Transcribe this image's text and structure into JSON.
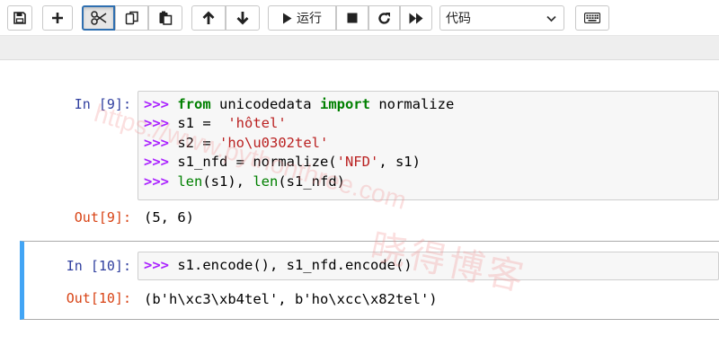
{
  "toolbar": {
    "run_label": "运行",
    "cell_type": "代码",
    "icons": [
      "save-icon",
      "plus-icon",
      "scissors-icon",
      "copy-icon",
      "paste-icon",
      "arrow-up-icon",
      "arrow-down-icon",
      "play-icon",
      "stop-icon",
      "restart-icon",
      "fast-forward-icon",
      "keyboard-icon"
    ]
  },
  "cells": [
    {
      "in_prompt": "In [9]:",
      "lines": [
        [
          {
            "t": ">>> ",
            "c": "pm"
          },
          {
            "t": "from",
            "c": "kw"
          },
          {
            "t": " unicodedata ",
            "c": ""
          },
          {
            "t": "import",
            "c": "kw"
          },
          {
            "t": " normalize",
            "c": ""
          }
        ],
        [
          {
            "t": ">>> ",
            "c": "pm"
          },
          {
            "t": "s1 = ",
            "c": ""
          },
          {
            "t": " 'hôtel'",
            "c": "st"
          }
        ],
        [
          {
            "t": ">>> ",
            "c": "pm"
          },
          {
            "t": "s2 = ",
            "c": ""
          },
          {
            "t": "'ho\\u0302tel'",
            "c": "st"
          }
        ],
        [
          {
            "t": ">>> ",
            "c": "pm"
          },
          {
            "t": "s1_nfd = normalize(",
            "c": ""
          },
          {
            "t": "'NFD'",
            "c": "st"
          },
          {
            "t": ", s1)",
            "c": ""
          }
        ],
        [
          {
            "t": ">>> ",
            "c": "pm"
          },
          {
            "t": "len",
            "c": "bi"
          },
          {
            "t": "(s1), ",
            "c": ""
          },
          {
            "t": "len",
            "c": "bi"
          },
          {
            "t": "(s1_nfd)",
            "c": ""
          }
        ]
      ],
      "out_prompt": "Out[9]:",
      "output": "(5, 6)"
    },
    {
      "in_prompt": "In [10]:",
      "lines": [
        [
          {
            "t": ">>> ",
            "c": "pm"
          },
          {
            "t": "s1.encode(), s1_nfd.encode()",
            "c": ""
          }
        ]
      ],
      "out_prompt": "Out[10]:",
      "output": "(b'h\\xc3\\xb4tel', b'ho\\xcc\\x82tel')"
    }
  ],
  "watermark": {
    "url": "https://www.pythonthree.com",
    "cn": "晓得博客"
  }
}
